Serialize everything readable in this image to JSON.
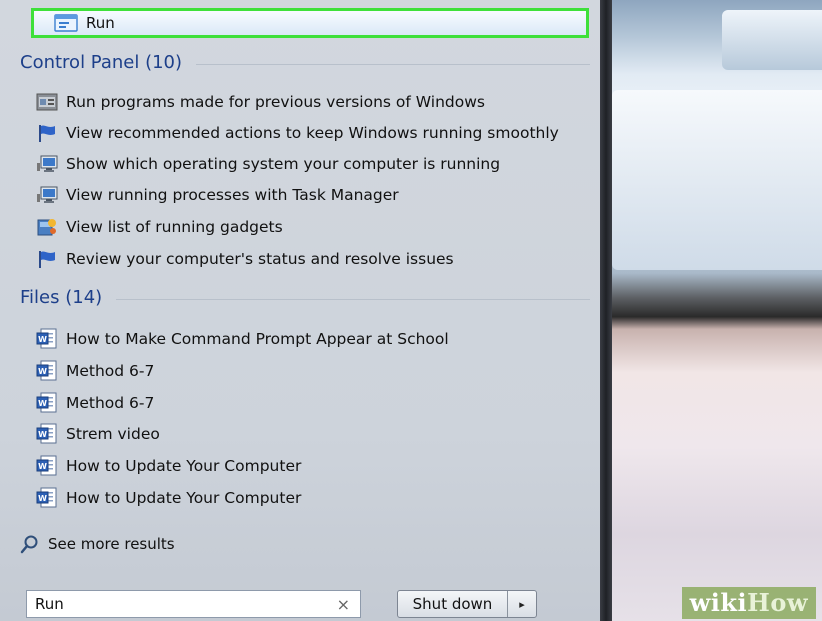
{
  "run_item": {
    "label": "Run"
  },
  "control_panel": {
    "title": "Control Panel (10)",
    "items": [
      {
        "label": "Run programs made for previous versions of Windows",
        "icon": "compat-program-icon"
      },
      {
        "label": "View recommended actions to keep Windows running smoothly",
        "icon": "action-center-flag-icon"
      },
      {
        "label": "Show which operating system your computer is running",
        "icon": "system-monitor-icon"
      },
      {
        "label": "View running processes with Task Manager",
        "icon": "system-monitor-icon"
      },
      {
        "label": "View list of running gadgets",
        "icon": "gadgets-icon"
      },
      {
        "label": "Review your computer's status and resolve issues",
        "icon": "action-center-flag-icon"
      }
    ]
  },
  "files": {
    "title": "Files (14)",
    "items": [
      {
        "label": "How to Make Command Prompt Appear at School"
      },
      {
        "label": "Method 6-7"
      },
      {
        "label": "Method 6-7"
      },
      {
        "label": "Strem video"
      },
      {
        "label": "How to Update Your Computer"
      },
      {
        "label": "How to Update Your Computer"
      }
    ]
  },
  "see_more": {
    "label": "See more results"
  },
  "search": {
    "value": "Run",
    "clear_glyph": "×"
  },
  "shutdown": {
    "label": "Shut down",
    "arrow_glyph": "▸"
  },
  "watermark": {
    "part1": "wiki",
    "part2": "How"
  },
  "colors": {
    "highlight_border": "#3ee03a",
    "section_title": "#1d3f8a"
  }
}
